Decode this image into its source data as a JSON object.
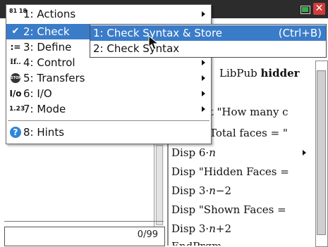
{
  "main_menu": {
    "items": [
      {
        "number": "1",
        "label": "1: Actions",
        "icon": "actions-icon",
        "icon_glyph": "81 18"
      },
      {
        "number": "2",
        "label": "2: Check",
        "icon": "check-icon",
        "icon_glyph": "✔"
      },
      {
        "number": "3",
        "label": "3: Define",
        "icon": "define-icon",
        "icon_glyph": ":="
      },
      {
        "number": "4",
        "label": "4: Control",
        "icon": "control-icon",
        "icon_glyph": "If.."
      },
      {
        "number": "5",
        "label": "5: Transfers",
        "icon": "stop-icon",
        "icon_glyph": "STOP"
      },
      {
        "number": "6",
        "label": "6: I/O",
        "icon": "io-icon",
        "icon_glyph": "I/o"
      },
      {
        "number": "7",
        "label": "7: Mode",
        "icon": "mode-icon",
        "icon_glyph": "1.23"
      },
      {
        "number": "8",
        "label": "8: Hints",
        "icon": "hints-icon",
        "icon_glyph": "?"
      }
    ]
  },
  "sub_menu": {
    "items": [
      {
        "label": "1: Check Syntax & Store",
        "shortcut": "(Ctrl+B)"
      },
      {
        "label": "2: Check Syntax",
        "shortcut": ""
      }
    ]
  },
  "editor": {
    "lines": [
      {
        "pre": "LibPub ",
        "bold": "hidder"
      },
      {
        "pre": "st \"How many c"
      },
      {
        "pre": "Total faces = \""
      },
      {
        "pre": "Disp 6·",
        "var": "n"
      },
      {
        "pre": "Disp \"Hidden Faces ="
      },
      {
        "pre": "Disp 3·",
        "var": "n",
        "post": "−2"
      },
      {
        "pre": "Disp \"Shown Faces ="
      },
      {
        "pre": "Disp 3·",
        "var": "n",
        "post": "+2"
      },
      {
        "pre": "EndPrgm"
      }
    ]
  },
  "left_pane": {
    "counter": "0/99"
  },
  "colors": {
    "selection": "#3b7cc9",
    "titlebar": "#2c2c2c",
    "close": "#d23b3b",
    "battery": "#3aa847"
  }
}
